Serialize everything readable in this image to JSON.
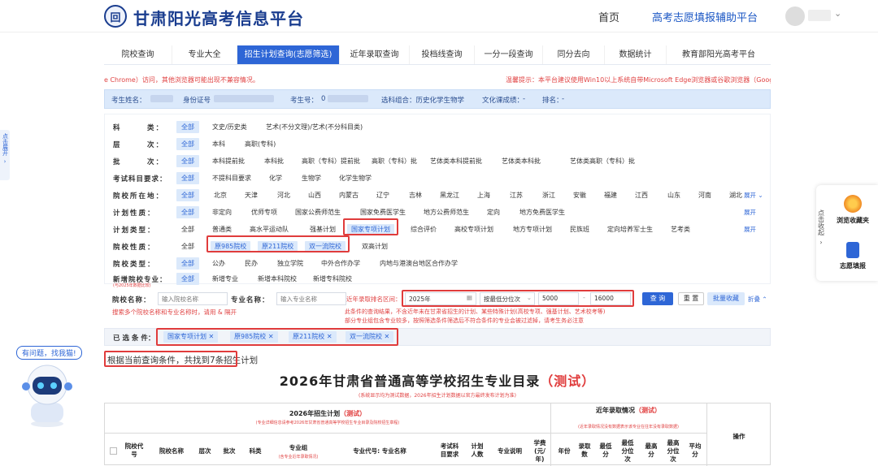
{
  "header": {
    "emblem": "回",
    "site_title": "甘肃阳光高考信息平台",
    "nav_home": "首页",
    "nav_assist": "高考志愿填报辅助平台"
  },
  "tabs": [
    "院校查询",
    "专业大全",
    "招生计划查询(志愿筛选)",
    "近年录取查询",
    "投档线查询",
    "一分一段查询",
    "同分去向",
    "数据统计",
    "教育部阳光高考平台"
  ],
  "notice": {
    "left": "e Chrome）访问，其他浏览器可能出现不兼容情况。",
    "right": "温馨提示：本平台建议使用Win10以上系统自带Microsoft Edge浏览器或谷歌浏览器（Googl"
  },
  "infobar": {
    "name_label": "考生姓名：",
    "id_label": "身份证号",
    "exam_no_label": "考生号：",
    "exam_no_prefix": "0",
    "subjects": "选科组合：历史化学生物学",
    "culture_score": "文化课成绩：",
    "culture_score_value": "-",
    "rank": "排名：",
    "rank_value": "-"
  },
  "filters": {
    "rows": [
      {
        "label": "科　　　类：",
        "all": "全部",
        "options": [
          "文史/历史类",
          "艺术(不分文理)/艺术(不分科目类)"
        ]
      },
      {
        "label": "层　　　次：",
        "all": "全部",
        "options": [
          "本科",
          "高职(专科)"
        ]
      },
      {
        "label": "批　　　次：",
        "all": "全部",
        "options": [
          "本科提前批",
          "本科批",
          "高职（专科）提前批",
          "高职（专科）批",
          "艺体类本科提前批",
          "艺体类本科批",
          "艺体类高职（专科）批"
        ]
      },
      {
        "label": "考试科目要求：",
        "all": "全部",
        "options": [
          "不提科目要求",
          "化学",
          "生物学",
          "化学生物学"
        ]
      },
      {
        "label": "院校所在地：",
        "all": "全部",
        "options": [
          "北京",
          "天津",
          "河北",
          "山西",
          "内蒙古",
          "辽宁",
          "吉林",
          "黑龙江",
          "上海",
          "江苏",
          "浙江",
          "安徽",
          "福建",
          "江西",
          "山东",
          "河南",
          "湖北"
        ]
      },
      {
        "label": "计划性质：",
        "all": "全部",
        "options": [
          "非定向",
          "优师专项",
          "国家公费师范生",
          "国家免费医学生",
          "地方公费师范生",
          "定向",
          "地方免费医学生"
        ]
      },
      {
        "label": "计划类型：",
        "all": "全部",
        "options": [
          "普通类",
          "高水平运动队",
          "强基计划",
          "国家专项计划",
          "综合评价",
          "高校专项计划",
          "地方专项计划",
          "民族班",
          "定向培养军士生",
          "艺考类"
        ]
      },
      {
        "label": "院校性质：",
        "all": "全部",
        "options": [
          "原985院校",
          "原211院校",
          "双一流院校",
          "双高计划"
        ]
      },
      {
        "label": "院校类型：",
        "all": "全部",
        "options": [
          "公办",
          "民办",
          "独立学院",
          "中外合作办学",
          "内地与港澳台地区合作办学"
        ]
      },
      {
        "label": "新增院校专业：",
        "all": "全部",
        "options": [
          "新增专业",
          "新增本科院校",
          "新增专科院校"
        ]
      }
    ],
    "expand": "展开",
    "new_note": "(与2025年数据比较)"
  },
  "search": {
    "school_label": "院校名称：",
    "school_placeholder": "输入院校名称",
    "major_label": "专业名称：",
    "major_placeholder": "输入专业名称",
    "hint": "搜索多个院校名称和专业名称时，请用 & 隔开",
    "range_label": "近年录取排名区间：",
    "year": "2025年",
    "mode": "按最低分位次",
    "min": "5000",
    "dash": "-",
    "max": "16000",
    "note1": "此条件的查询结果，不含近年未在甘肃省招生的计划、某些特殊计划(高校专项、强基计划、艺术校考等)",
    "note2": "部分专业组包含专业较多，按照筛选条件筛选后不符合条件的专业会被过滤掉，请考生务必注意",
    "btn_query": "查 询",
    "btn_reset": "重 置",
    "btn_batch": "批量收藏",
    "collapse": "折叠"
  },
  "selected": {
    "label": "已 选 条 件：",
    "tags": [
      "国家专项计划",
      "原985院校",
      "原211院校",
      "双一流院校"
    ]
  },
  "result_text": "根据当前查询条件，共找到7条招生计划",
  "catalog": {
    "title": "2026年甘肃省普通高等学校招生专业目录",
    "title_test": "（测试）",
    "subtitle": "(系统显示均为测试数据，2026年招生计划数据以官方最终发布计划为准)",
    "plan_header": "2026年招生计划",
    "plan_header_test": "（测试）",
    "plan_note": "(专业详细信息请参考2026年甘肃省普通高等学校招生专业目录及院校招生章程)",
    "history_header": "近年录取情况",
    "history_header_test": "（测试）",
    "history_note": "(近年录取情况没有数据表示该专业在往年没有录取数据)",
    "ops": "操作",
    "columns": [
      "院校代号",
      "院校名称",
      "层次",
      "批次",
      "科类",
      "专业组",
      "专业代号: 专业名称",
      "考试科目要求",
      "计划人数",
      "专业说明",
      "学费(元/年)",
      "年份",
      "录取数",
      "最低分",
      "最低分位次",
      "最高分",
      "最高分位次",
      "平均分"
    ],
    "group_note": "(含专业近年录取情况)"
  },
  "sidebar": {
    "left_tab": "点击展开"
  },
  "right_widget": {
    "side": "点击收起",
    "favorites": "浏览收藏夹",
    "apply": "志愿填报"
  },
  "robot": {
    "bubble": "有问题，找我猫!"
  },
  "colors": {
    "brand": "#1a3d8f",
    "accent": "#2e66d6",
    "highlight": "#e03c3c"
  }
}
